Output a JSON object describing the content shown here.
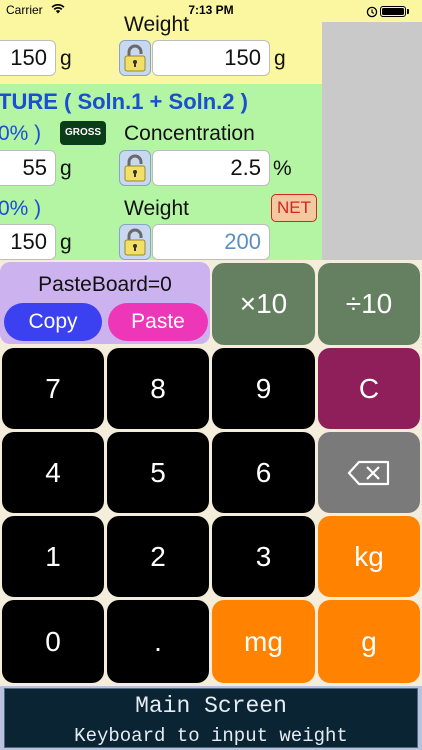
{
  "status_bar": {
    "carrier": "Carrier",
    "time": "7:13 PM"
  },
  "top": {
    "weight_label_top": "Weight",
    "row1": {
      "left_value": "150",
      "left_unit": "g",
      "right_value": "150",
      "right_unit": "g"
    },
    "mixture_title": "TURE ( Soln.1 + Soln.2 )",
    "row2": {
      "left_pct": "0% )",
      "gross_label": "GROSS",
      "concentration_label": "Concentration"
    },
    "row3": {
      "left_value": "55",
      "left_unit": "g",
      "conc_value": "2.5",
      "conc_unit": "%"
    },
    "row4": {
      "left_pct": "0% )",
      "weight_label": "Weight",
      "net_label": "NET"
    },
    "row5": {
      "left_value": "150",
      "left_unit": "g",
      "weight_placeholder": "200"
    }
  },
  "keyboard": {
    "pasteboard_text": "PasteBoard=0",
    "copy_label": "Copy",
    "paste_label": "Paste",
    "times10": "×10",
    "div10": "÷10",
    "k7": "7",
    "k8": "8",
    "k9": "9",
    "kc": "C",
    "k4": "4",
    "k5": "5",
    "k6": "6",
    "kdel": "⌫",
    "k1": "1",
    "k2": "2",
    "k3": "3",
    "kkg": "kg",
    "k0": "0",
    "kdot": ".",
    "kmg": "mg",
    "kg_unit": "g"
  },
  "footer": {
    "title": "Main Screen",
    "subtitle": "Keyboard to input weight"
  }
}
